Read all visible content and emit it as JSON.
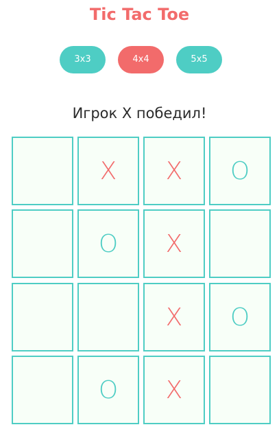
{
  "title": "Tic Tac Toe",
  "size_buttons": [
    {
      "label": "3x3",
      "color": "#4ecdc4"
    },
    {
      "label": "4x4",
      "color": "#f26b6b"
    },
    {
      "label": "5x5",
      "color": "#4ecdc4"
    }
  ],
  "status": "Игрок X победил!",
  "colors": {
    "title": "#f26b6b",
    "x_mark": "#f26b6b",
    "o_mark": "#4ecdc4",
    "cell_border": "#4ecdc4",
    "cell_background": "#f8fff8"
  },
  "board": [
    [
      "",
      "X",
      "X",
      "O"
    ],
    [
      "",
      "O",
      "X",
      ""
    ],
    [
      "",
      "",
      "X",
      "O"
    ],
    [
      "",
      "O",
      "X",
      ""
    ]
  ]
}
